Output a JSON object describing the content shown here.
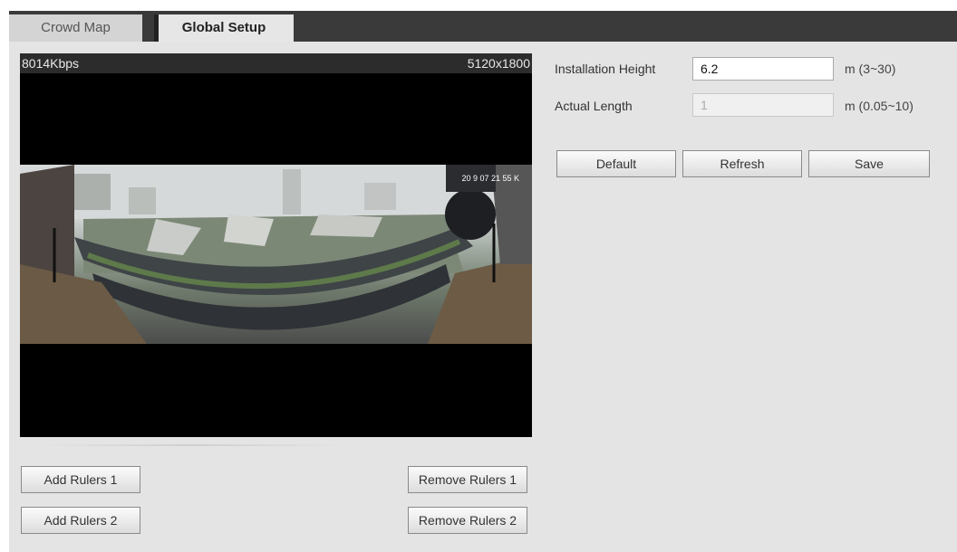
{
  "tabs": {
    "crowd_map": "Crowd Map",
    "global_setup": "Global Setup"
  },
  "video": {
    "bitrate": "8014Kbps",
    "resolution": "5120x1800",
    "osd_time": "20 9 07 21 55 K"
  },
  "rulers": {
    "add1": "Add Rulers 1",
    "add2": "Add Rulers 2",
    "remove1": "Remove Rulers 1",
    "remove2": "Remove Rulers 2"
  },
  "form": {
    "installation_height": {
      "label": "Installation Height",
      "value": "6.2",
      "unit": "m (3~30)"
    },
    "actual_length": {
      "label": "Actual Length",
      "value": "1",
      "unit": "m (0.05~10)"
    }
  },
  "actions": {
    "default": "Default",
    "refresh": "Refresh",
    "save": "Save"
  },
  "colors": {
    "tab_bar": "#3a3a3a",
    "panel": "#e4e4e4",
    "video_bg": "#000000"
  }
}
